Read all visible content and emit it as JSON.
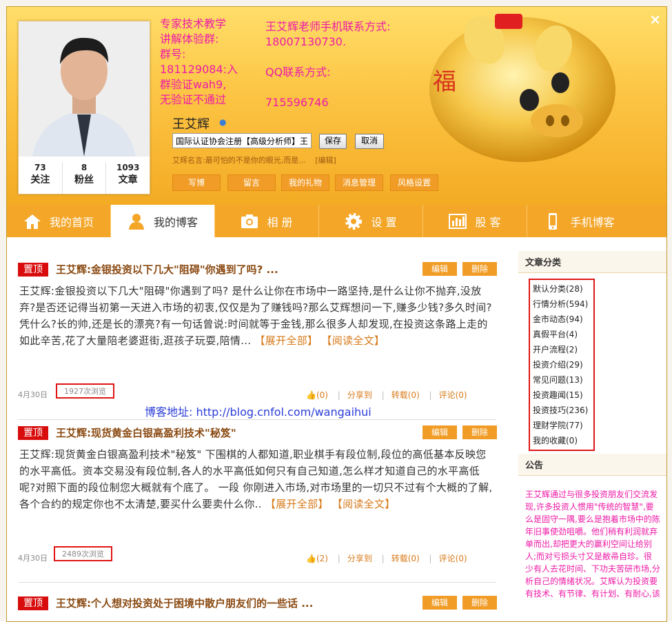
{
  "header": {
    "group_info": [
      "专家技术教学",
      "讲解体验群:",
      "群号:",
      "181129084:入",
      "群验证wah9,",
      "无验证不通过"
    ],
    "contact": [
      "王艾辉老师手机联系方式:",
      "18007130730.",
      "",
      "QQ联系方式:",
      "",
      "715596746"
    ],
    "close_label": "×"
  },
  "profile": {
    "stats": [
      {
        "value": "73",
        "label": "关注"
      },
      {
        "value": "8",
        "label": "粉丝"
      },
      {
        "value": "1093",
        "label": "文章"
      }
    ],
    "username": "王艾辉",
    "signature_value": "国际认证协会注册【高级分析师】王",
    "save_label": "保存",
    "cancel_label": "取消",
    "motto": "艾辉名言:最可怕的不是你的眼光,而是...",
    "motto_edit": "[编辑]",
    "buttons": [
      "写博",
      "留言",
      "我的礼物",
      "消息管理",
      "风格设置"
    ]
  },
  "nav": {
    "items": [
      "我的首页",
      "我的博客",
      "相 册",
      "设 置",
      "股 客",
      "手机博客"
    ]
  },
  "posts": [
    {
      "badge": "置顶",
      "title": "王艾辉:金银投资以下几大\"阻碍\"你遇到了吗? ...",
      "edit": "编辑",
      "delete": "删除",
      "body": "王艾辉:金银投资以下几大\"阻碍\"你遇到了吗? 是什么让你在市场中一路坚持,是什么让你不抛弃,没放弃?是否还记得当初第一天进入市场的初衷,仅仅是为了赚钱吗?那么艾辉想问一下,赚多少钱?多久时间?凭什么?长的帅,还是长的漂亮?有一句话曾说:时间就等于金钱,那么很多人却发现,在投资这条路上走的如此辛苦,花了大量陪老婆逛街,逛孩子玩耍,陪情...",
      "expand": "【展开全部】",
      "read": "【阅读全文】",
      "date": "4月30日",
      "views": "1927次浏览",
      "likes": "(0)",
      "share": "分享到",
      "repost": "转载(0)",
      "comment": "评论(0)"
    },
    {
      "badge": "置顶",
      "title": "王艾辉:现货黄金白银高盈利技术\"秘笈\"",
      "edit": "编辑",
      "delete": "删除",
      "body": "王艾辉:现货黄金白银高盈利技术\"秘笈\" 下围棋的人都知道,职业棋手有段位制,段位的高低基本反映您的水平高低。资本交易没有段位制,各人的水平高低如何只有自己知道,怎么样才知道自己的水平高低呢?对照下面的段位制您大概就有个底了。 一段 你刚进入市场,对市场里的一切只不过有个大概的了解,各个合约的规定你也不太清楚,要买什么要卖什么你..",
      "expand": "【展开全部】",
      "read": "【阅读全文】",
      "date": "4月30日",
      "views": "2489次浏览",
      "likes": "(2)",
      "share": "分享到",
      "repost": "转载(0)",
      "comment": "评论(0)"
    },
    {
      "badge": "置顶",
      "title": "王艾辉:个人想对投资处于困境中散户朋友们的一些话 ...",
      "edit": "编辑",
      "delete": "删除"
    }
  ],
  "blog_link": "博客地址: http://blog.cnfol.com/wangaihui",
  "sidebar": {
    "categories_title": "文章分类",
    "categories": [
      "默认分类(28)",
      "行情分析(594)",
      "金市动态(94)",
      "真假平台(4)",
      "开户流程(2)",
      "投资介绍(29)",
      "常见问题(13)",
      "投资趣闻(15)",
      "投资技巧(236)",
      "理财学院(77)",
      "我的收藏(0)"
    ],
    "notice_title": "公告",
    "notice_text": "王艾辉通过与很多投资朋友们交流发现,许多投资人惯用\"传统的智慧\",要么是固守一隅,要么是抱着市场中的陈年旧事使劲咀嚼。他们稍有利润就弃单而出,却把更大的赢利空间让给别人;而对亏损头寸又是敝帚自珍。很少有人去花时间、下功夫苦研市场,分析自己的情绪状况。艾辉认为投资要有技术、有节律、有计划、有耐心,该"
  },
  "colors": {
    "accent_orange": "#f19c26",
    "top_badge_red": "#d80c0c",
    "highlight_pink": "#ee1aa6",
    "link_blue": "#2a3cd8"
  }
}
